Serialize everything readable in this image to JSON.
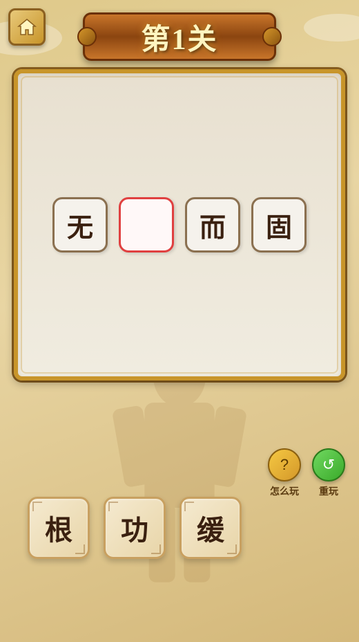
{
  "app": {
    "title": "第1关"
  },
  "header": {
    "home_label": "home",
    "level_text": "第1关"
  },
  "game": {
    "slots": [
      {
        "char": "无",
        "empty": false
      },
      {
        "char": "",
        "empty": true
      },
      {
        "char": "而",
        "empty": false
      },
      {
        "char": "固",
        "empty": false
      }
    ]
  },
  "actions": [
    {
      "id": "help",
      "label": "怎么玩",
      "icon": "?"
    },
    {
      "id": "replay",
      "label": "重玩",
      "icon": "↺"
    }
  ],
  "answer_tiles": [
    {
      "char": "根"
    },
    {
      "char": "功"
    },
    {
      "char": "缓"
    }
  ],
  "colors": {
    "bg": "#e8d5a3",
    "board_border": "#c8952a",
    "tile_bg": "#f5ead0",
    "tile_border": "#c8a060",
    "text": "#3a2010",
    "slot_border": "#8b7050",
    "empty_border": "#e04040"
  }
}
